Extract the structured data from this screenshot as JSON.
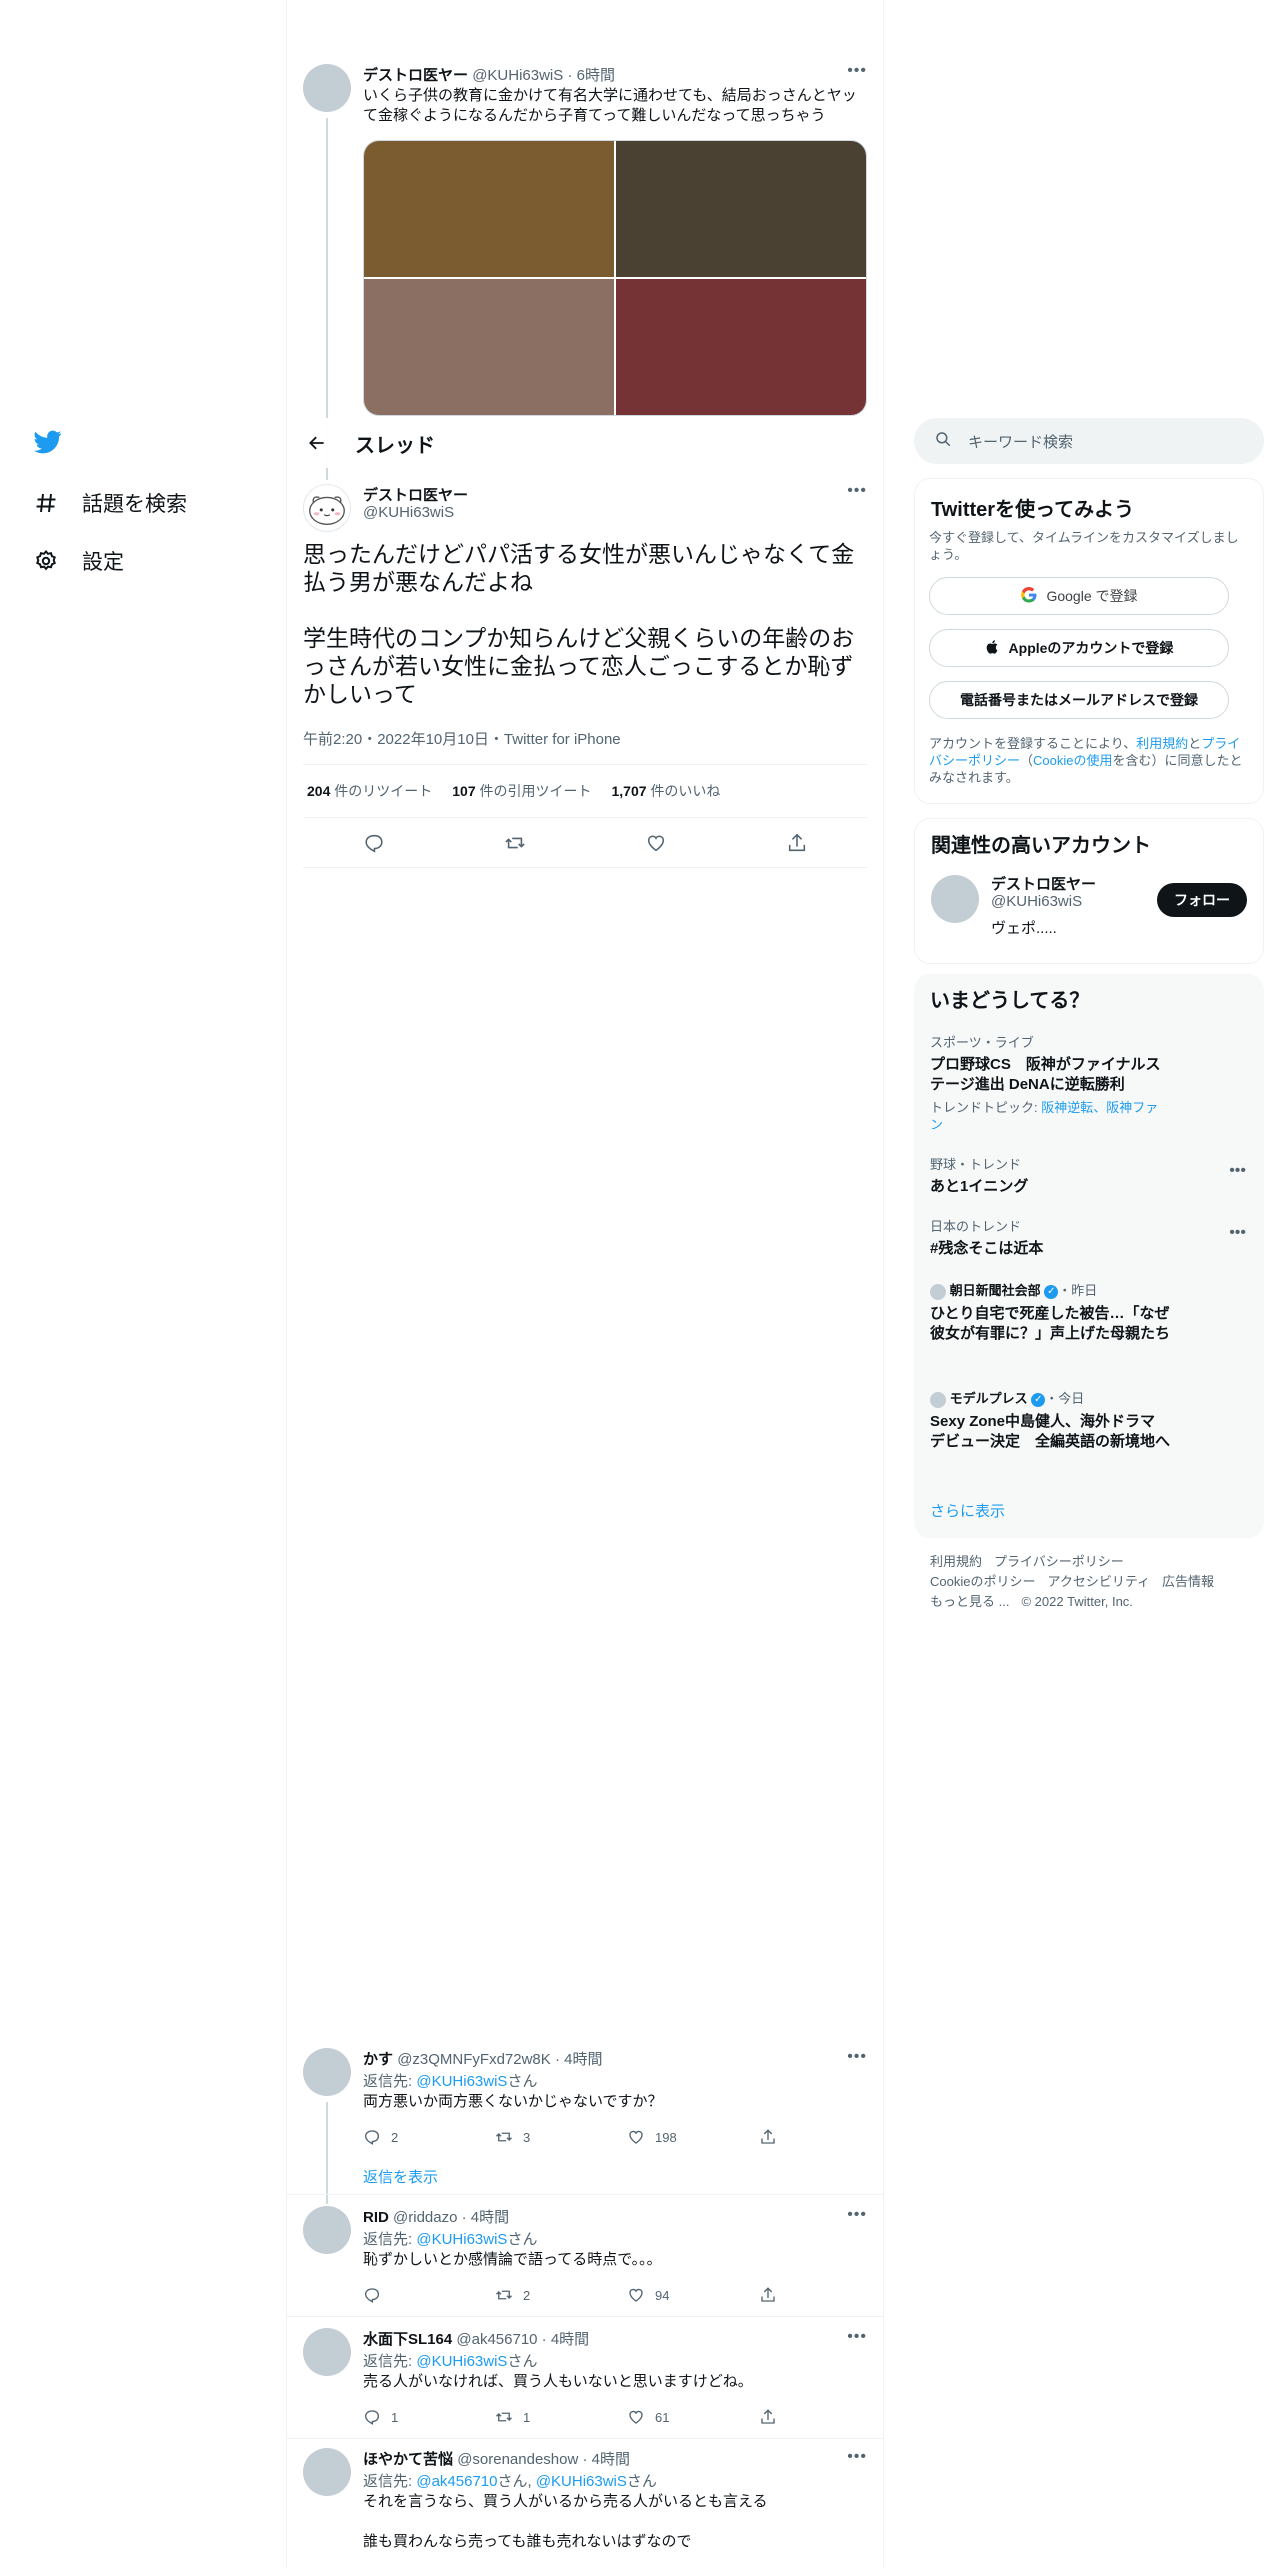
{
  "nav": {
    "items": [
      {
        "label": "話題を検索",
        "icon": "hashtag-icon"
      },
      {
        "label": "設定",
        "icon": "gear-icon"
      }
    ]
  },
  "parent_tweet": {
    "name": "デストロ医ヤー",
    "handle": "@KUHi63wiS",
    "time": "6時間",
    "text": "いくら子供の教育に金かけて有名大学に通わせても、結局おっさんとヤッて金稼ぐようになるんだから子育てって難しいんだなって思っちゃう",
    "media_colors": [
      "#7a5c30",
      "#4b4133",
      "#8a6f62",
      "#763335"
    ]
  },
  "header": {
    "title": "スレッド"
  },
  "focus_tweet": {
    "name": "デストロ医ヤー",
    "handle": "@KUHi63wiS",
    "text_p1": "思ったんだけどパパ活する女性が悪いんじゃなくて金払う男が悪なんだよね",
    "text_p2": "学生時代のコンプか知らんけど父親くらいの年齢のおっさんが若い女性に金払って恋人ごっこするとか恥ずかしいって",
    "meta": "午前2:20・2022年10月10日・Twitter for iPhone",
    "retweets": "204",
    "retweets_label": "件のリツイート",
    "quotes": "107",
    "quotes_label": "件の引用ツイート",
    "likes": "1,707",
    "likes_label": "件のいいね"
  },
  "replies": [
    {
      "name": "かす",
      "handle": "@z3QMNFyFxd72w8K",
      "time": "4時間",
      "to_prefix": "返信先: ",
      "to": "@KUHi63wiS",
      "to_suffix": "さん",
      "text": "両方悪いか両方悪くないかじゃないですか？",
      "reply_count": "2",
      "rt_count": "3",
      "like_count": "198"
    },
    {
      "name": "RID",
      "handle": "@riddazo",
      "time": "4時間",
      "to_prefix": "返信先: ",
      "to": "@KUHi63wiS",
      "to_suffix": "さん",
      "text": "恥ずかしいとか感情論で語ってる時点で。。。",
      "reply_count": "",
      "rt_count": "2",
      "like_count": "94"
    },
    {
      "name": "水面下SL164",
      "handle": "@ak456710",
      "time": "4時間",
      "to_prefix": "返信先: ",
      "to": "@KUHi63wiS",
      "to_suffix": "さん",
      "text": "売る人がいなければ、買う人もいないと思いますけどね。",
      "reply_count": "1",
      "rt_count": "1",
      "like_count": "61"
    },
    {
      "name": "ほやかて苦悩",
      "handle": "@sorenandeshow",
      "time": "4時間",
      "to_prefix": "返信先: ",
      "to": "@ak456710",
      "to_mid": "さん, ",
      "to2": "@KUHi63wiS",
      "to_suffix": "さん",
      "text": "それを言うなら、買う人がいるから売る人がいるとも言える",
      "text2": "誰も買わんなら売っても誰も売れないはずなので"
    }
  ],
  "show_replies": "返信を表示",
  "search": {
    "placeholder": "キーワード検索"
  },
  "signup": {
    "title": "Twitterを使ってみよう",
    "subtitle": "今すぐ登録して、タイムラインをカスタマイズしましょう。",
    "google": "Google で登録",
    "apple": "Appleのアカウントで登録",
    "phone": "電話番号またはメールアドレスで登録",
    "legal_1": "アカウントを登録することにより、",
    "legal_terms": "利用規約",
    "legal_2": "と",
    "legal_privacy": "プライバシーポリシー",
    "legal_3": "（",
    "legal_cookie": "Cookieの使用",
    "legal_4": "を含む）に同意したとみなされます。"
  },
  "related": {
    "title": "関連性の高いアカウント",
    "name": "デストロ医ヤー",
    "handle": "@KUHi63wiS",
    "bio": "ヴェポ.....",
    "follow": "フォロー"
  },
  "trends": {
    "title": "いまどうしてる？",
    "items": [
      {
        "cat": "スポーツ・ライブ",
        "name": "プロ野球CS　阪神がファイナルステージ進出 DeNAに逆転勝利",
        "topic_prefix": "トレンドトピック: ",
        "topic": "阪神逆転、阪神ファン"
      },
      {
        "cat": "野球・トレンド",
        "name": "あと1イニング"
      },
      {
        "cat": "日本のトレンド",
        "name": "#残念そこは近本"
      },
      {
        "cat": "朝日新聞社会部",
        "time": "・昨日",
        "name": "ひとり自宅で死産した被告…「なぜ彼女が有罪に？」声上げた母親たち"
      },
      {
        "cat": "モデルプレス",
        "time": "・今日",
        "name": "Sexy Zone中島健人、海外ドラマデビュー決定　全編英語の新境地へ"
      }
    ],
    "more": "さらに表示"
  },
  "footer": {
    "links": [
      "利用規約",
      "プライバシーポリシー",
      "Cookieのポリシー",
      "アクセシビリティ",
      "広告情報",
      "もっと見る ..."
    ],
    "copyright": "© 2022 Twitter, Inc."
  },
  "colors": {
    "accent": "#1d9bf0",
    "text": "#0f1419",
    "muted": "#536471"
  }
}
